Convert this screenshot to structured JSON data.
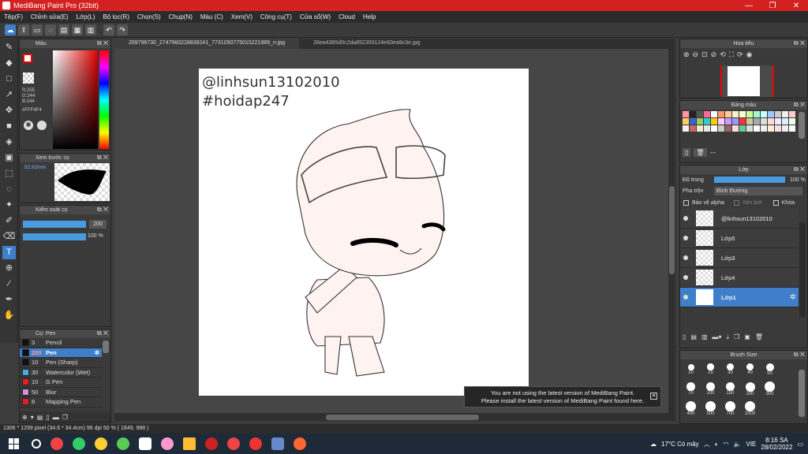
{
  "window": {
    "title": "MediBang Paint Pro (32bit)",
    "controls": [
      "—",
      "❐",
      "✕"
    ]
  },
  "menu": [
    "Tệp(F)",
    "Chỉnh sửa(E)",
    "Lớp(L)",
    "Bộ lọc(R)",
    "Chọn(S)",
    "Chụp(N)",
    "Màu (C)",
    "Xem(V)",
    "Công cụ(T)",
    "Cửa sổ(W)",
    "Cloud",
    "Help"
  ],
  "tabs": [
    "269796730_2747960228839241_7731050775015221989_n.jpg",
    "28ea4365d0c2da852393124e83ea9c3e.jpg"
  ],
  "color_panel": {
    "title": "Màu",
    "r": "R:255",
    "g": "G:244",
    "b": "B:244",
    "hex": "#FFF4F4"
  },
  "brush_preview": {
    "title": "Xem trước cọ",
    "size": "52.92mm"
  },
  "brush_control": {
    "title": "Kiểm soát cọ",
    "size_value": "200",
    "opacity_value": "100 %"
  },
  "brushes": {
    "title": "Cọ: Pen",
    "items": [
      {
        "size": "3",
        "name": "Pencil",
        "color": "#111111"
      },
      {
        "size": "200",
        "name": "Pen",
        "color": "#111111"
      },
      {
        "size": "10",
        "name": "Pen (Sharp)",
        "color": "#111111"
      },
      {
        "size": "30",
        "name": "Watercolor (Wet)",
        "color": "#4aa8e0"
      },
      {
        "size": "10",
        "name": "G Pen",
        "color": "#e02020"
      },
      {
        "size": "50",
        "name": "Blur",
        "color": "#d090e0"
      },
      {
        "size": "8",
        "name": "Mapping Pen",
        "color": "#e02020"
      }
    ]
  },
  "canvas_text": {
    "line1": "@linhsun13102010",
    "line2": "#hoidap247"
  },
  "notification": {
    "line1": "You are not using the latest version of MediBang Paint.",
    "line2": "Please install the latest version of MediBang Paint found here."
  },
  "navigator": {
    "title": "Hoa tiêu"
  },
  "palette": {
    "title": "Bảng màu",
    "add_label": "---",
    "colors": [
      "#ff9999",
      "#222222",
      "#555555",
      "#ff6699",
      "#ffffff",
      "#ff9966",
      "#ffcc99",
      "#ffeecc",
      "#ffffcc",
      "#ccff99",
      "#99ffcc",
      "#ccffff",
      "#99ccff",
      "#cccccc",
      "#eeeeee",
      "#ffcccc",
      "#ffcc66",
      "#3366cc",
      "#99cc66",
      "#33cccc",
      "#ffcc00",
      "#ffccff",
      "#cc99ff",
      "#9999ff",
      "#ff3333",
      "#cccc99",
      "#aaaaaa",
      "#dddddd",
      "#ffdddd",
      "#eeeeff",
      "#ddeeff",
      "#eeffee",
      "#ffeeee",
      "#cc6666",
      "#eeeecc",
      "#ddeedd",
      "#ffffff",
      "#cccccc",
      "#996666",
      "#ffdddd",
      "#66cc99",
      "#dddddd",
      "#ffffff",
      "#eeeeee",
      "#ffeedd",
      "#ffe0e0",
      "#f0f0f0",
      "#ffffff"
    ]
  },
  "layer_panel": {
    "title": "Lớp",
    "opacity_label": "Độ trong",
    "opacity_value": "100 %",
    "blend_label": "Pha trộn",
    "blend_value": "Bình thường",
    "alpha_label": "Bảo vệ alpha",
    "clip_label": "Xén bớt",
    "lock_label": "Khóa",
    "layers": [
      "@linhsun13102010",
      "Lớp5",
      "Lớp3",
      "Lớp4",
      "Lớp1"
    ]
  },
  "brush_size": {
    "title": "Brush Size",
    "sizes": [
      "20",
      "25",
      "30",
      "40",
      "50",
      "70",
      "100",
      "150",
      "200",
      "300",
      "400",
      "500",
      "700",
      "1000"
    ]
  },
  "status": "1306 * 1299 pixel  (34.6 * 34.4cm)  96 dpi  50 %  ( 1849, 988 )",
  "taskbar": {
    "weather": "17°C  Có mây",
    "lang": "VIE",
    "time": "8:16 SA",
    "date": "28/02/2022"
  }
}
